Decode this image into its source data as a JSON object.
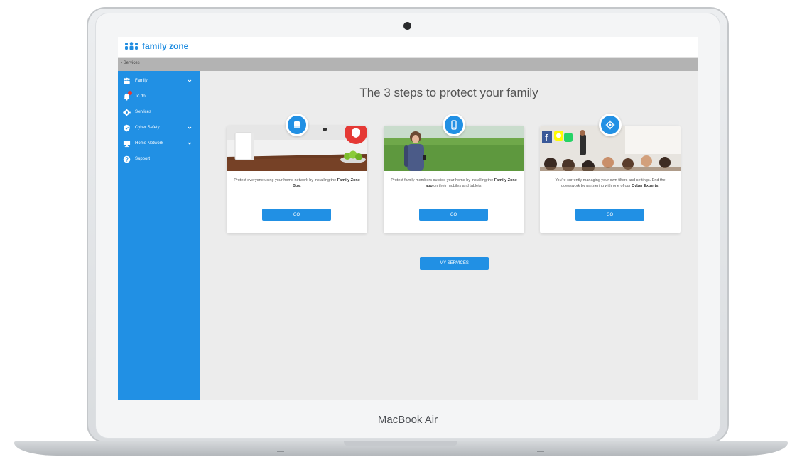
{
  "device": {
    "brand": "MacBook Air"
  },
  "app": {
    "logo_text": "family zone"
  },
  "breadcrumb": {
    "text": "Services"
  },
  "sidebar": {
    "items": [
      {
        "label": "Family",
        "icon": "family-icon",
        "expandable": true
      },
      {
        "label": "To do",
        "icon": "bell-icon",
        "expandable": false,
        "badge": true
      },
      {
        "label": "Services",
        "icon": "gear-icon",
        "expandable": false
      },
      {
        "label": "Cyber Safety",
        "icon": "shield-icon",
        "expandable": true
      },
      {
        "label": "Home Network",
        "icon": "monitor-icon",
        "expandable": true
      },
      {
        "label": "Support",
        "icon": "help-icon",
        "expandable": false
      }
    ]
  },
  "main": {
    "headline": "The 3 steps to protect your family",
    "cards": [
      {
        "icon": "box-icon",
        "text_before": "Protect everyone using your home network by installing the ",
        "text_bold": "Family Zone Box",
        "text_after": ".",
        "button": "GO"
      },
      {
        "icon": "phone-icon",
        "text_before": "Protect family members outside your home by installing the ",
        "text_bold": "Family Zone app",
        "text_after": " on their mobiles and tablets.",
        "button": "GO"
      },
      {
        "icon": "expert-icon",
        "text_before": "You're currently managing your own filters and settings. End the guesswork by partnering with one of our ",
        "text_bold": "Cyber Experts",
        "text_after": ".",
        "button": "GO"
      }
    ],
    "my_services_button": "MY SERVICES"
  },
  "colors": {
    "accent": "#2190e4",
    "sidebar": "#2190e4",
    "badge": "#e53935",
    "background": "#ececec"
  }
}
